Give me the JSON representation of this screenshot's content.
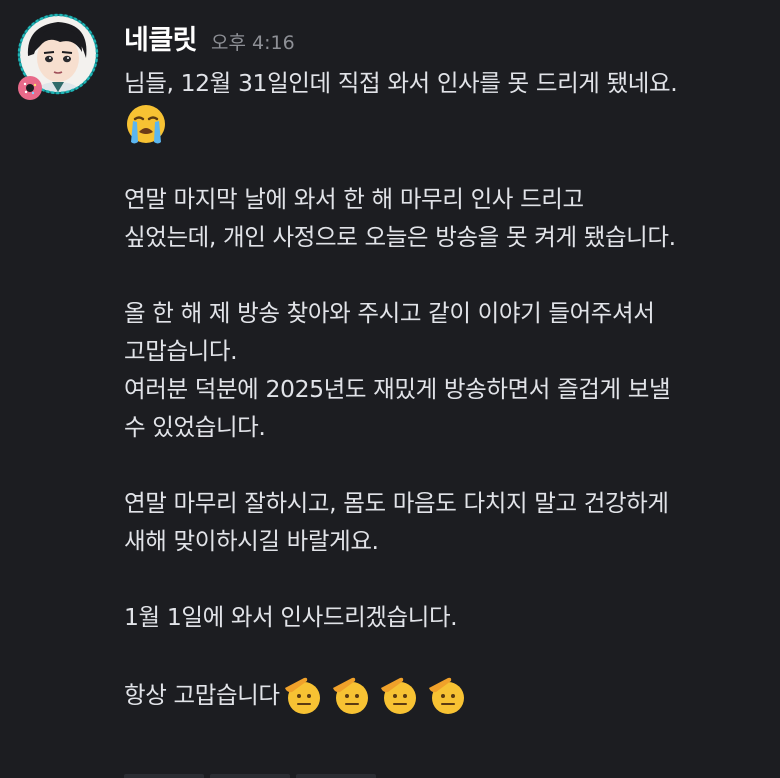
{
  "message": {
    "username": "네클릿",
    "timestamp": "오후 4:16",
    "lines": [
      "님들, 12월 31일인데 직접 와서 인사를 못 드리게 됐네요.",
      "연말 마지막 날에 와서 한 해 마무리 인사 드리고",
      "싶었는데, 개인 사정으로 오늘은 방송을 못 켜게 됐습니다.",
      "올 한 해 제 방송 찾아와 주시고 같이 이야기 들어주셔서",
      "고맙습니다.",
      "여러분 덕분에 2025년도 재밌게 방송하면서 즐겁게 보낼",
      "수 있었습니다.",
      "연말 마무리 잘하시고, 몸도 마음도 다치지 말고 건강하게",
      "새해 맞이하시길 바랄게요.",
      "1월 1일에 와서 인사드리겠습니다.",
      "항상 고맙습니다"
    ],
    "emojis": {
      "crying": "loudly-crying-face-emoji",
      "salute": "saluting-face-emoji"
    }
  },
  "colors": {
    "background": "#1c1d21",
    "text": "#e1e3e8",
    "username": "#ffffff",
    "timestamp": "#8e9096",
    "avatar_border": "#1fb5b5"
  }
}
